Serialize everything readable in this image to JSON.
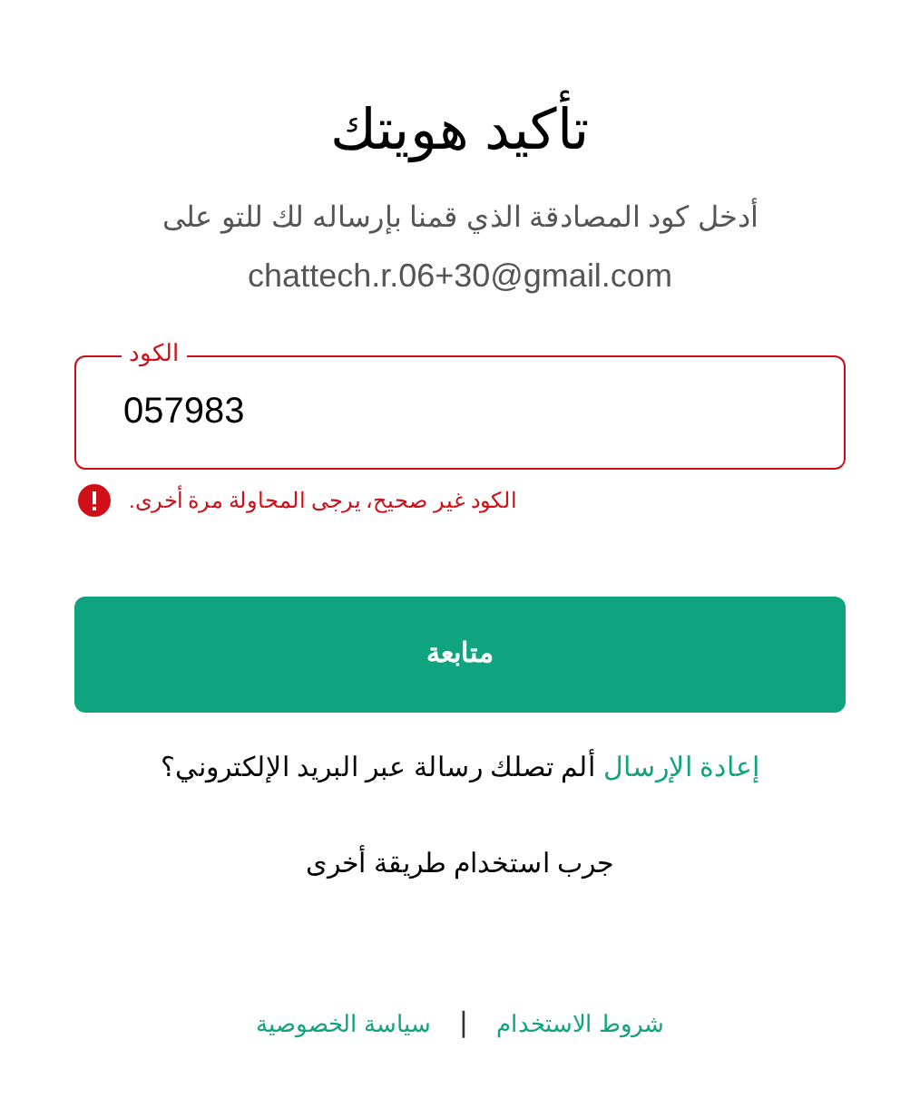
{
  "title": "تأكيد هويتك",
  "subtitle": "أدخل كود المصادقة الذي قمنا بإرساله لك للتو على",
  "email": "chattech.r.06+30@gmail.com",
  "code_field": {
    "label": "الكود",
    "value": "057983",
    "invalid": true,
    "error": "الكود غير صحيح، يرجى المحاولة مرة أخرى."
  },
  "continue_button": "متابعة",
  "resend": {
    "link": "إعادة الإرسال",
    "text": "ألم تصلك رسالة عبر البريد الإلكتروني؟"
  },
  "other_method": "جرب استخدام طريقة أخرى",
  "footer": {
    "links": [
      "شروط الاستخدام",
      "سياسة الخصوصية"
    ],
    "separator": "|"
  }
}
